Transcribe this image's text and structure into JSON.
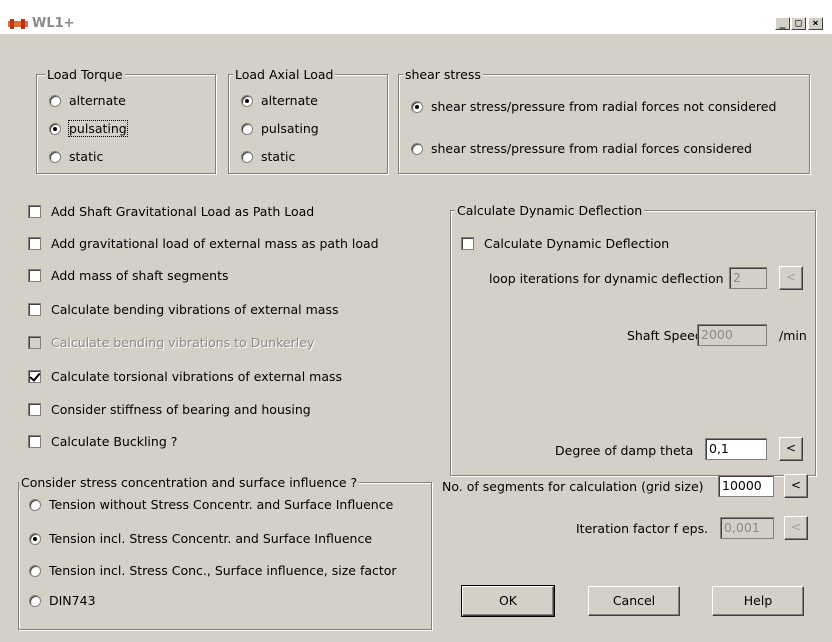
{
  "window": {
    "title": "WL1+",
    "minimize": "_",
    "maximize": "□",
    "close": "×"
  },
  "load_torque": {
    "legend": "Load Torque",
    "options": [
      "alternate",
      "pulsating",
      "static"
    ],
    "selected": "pulsating"
  },
  "load_axial": {
    "legend": "Load Axial Load",
    "options": [
      "alternate",
      "pulsating",
      "static"
    ],
    "selected": "alternate"
  },
  "shear_stress": {
    "legend": "shear stress",
    "options": [
      "shear stress/pressure from radial forces not considered",
      "shear stress/pressure from radial forces considered"
    ],
    "selected": "shear stress/pressure from radial forces not considered"
  },
  "checkboxes": [
    {
      "label": "Add Shaft Gravitational Load as Path Load",
      "checked": false,
      "enabled": true
    },
    {
      "label": "Add gravitational load of external mass as path load",
      "checked": false,
      "enabled": true
    },
    {
      "label": "Add mass of shaft segments",
      "checked": false,
      "enabled": true
    },
    {
      "label": "Calculate bending vibrations of external mass",
      "checked": false,
      "enabled": true
    },
    {
      "label": "Calculate bending vibrations to Dunkerley",
      "checked": false,
      "enabled": false
    },
    {
      "label": "Calculate torsional vibrations of external mass",
      "checked": true,
      "enabled": true
    },
    {
      "label": "Consider stiffness of bearing and housing",
      "checked": false,
      "enabled": true
    },
    {
      "label": "Calculate Buckling ?",
      "checked": false,
      "enabled": true
    }
  ],
  "stress_concentration": {
    "legend": "Consider stress concentration and surface influence ?",
    "options": [
      "Tension without Stress Concentr. and Surface Influence",
      "Tension incl. Stress Concentr. and Surface Influence",
      "Tension incl. Stress Conc., Surface influence, size factor",
      "DIN743"
    ],
    "selected": "Tension incl. Stress Concentr. and Surface Influence"
  },
  "dynamic_deflection": {
    "legend": "Calculate Dynamic Deflection",
    "checkbox_label": "Calculate Dynamic Deflection",
    "checked": false,
    "loop_label": "loop iterations for dynamic deflection",
    "loop_value": "2",
    "speed_label": "Shaft Speed",
    "speed_value": "2000",
    "speed_unit": "/min",
    "damp_label": "Degree of damp theta",
    "damp_value": "0,1",
    "arrow": "<"
  },
  "segments": {
    "label": "No. of segments for calculation (grid size)",
    "value": "10000",
    "iteration_label": "Iteration factor f eps.",
    "iteration_value": "0,001",
    "arrow": "<"
  },
  "buttons": {
    "ok": "OK",
    "cancel": "Cancel",
    "help": "Help"
  }
}
